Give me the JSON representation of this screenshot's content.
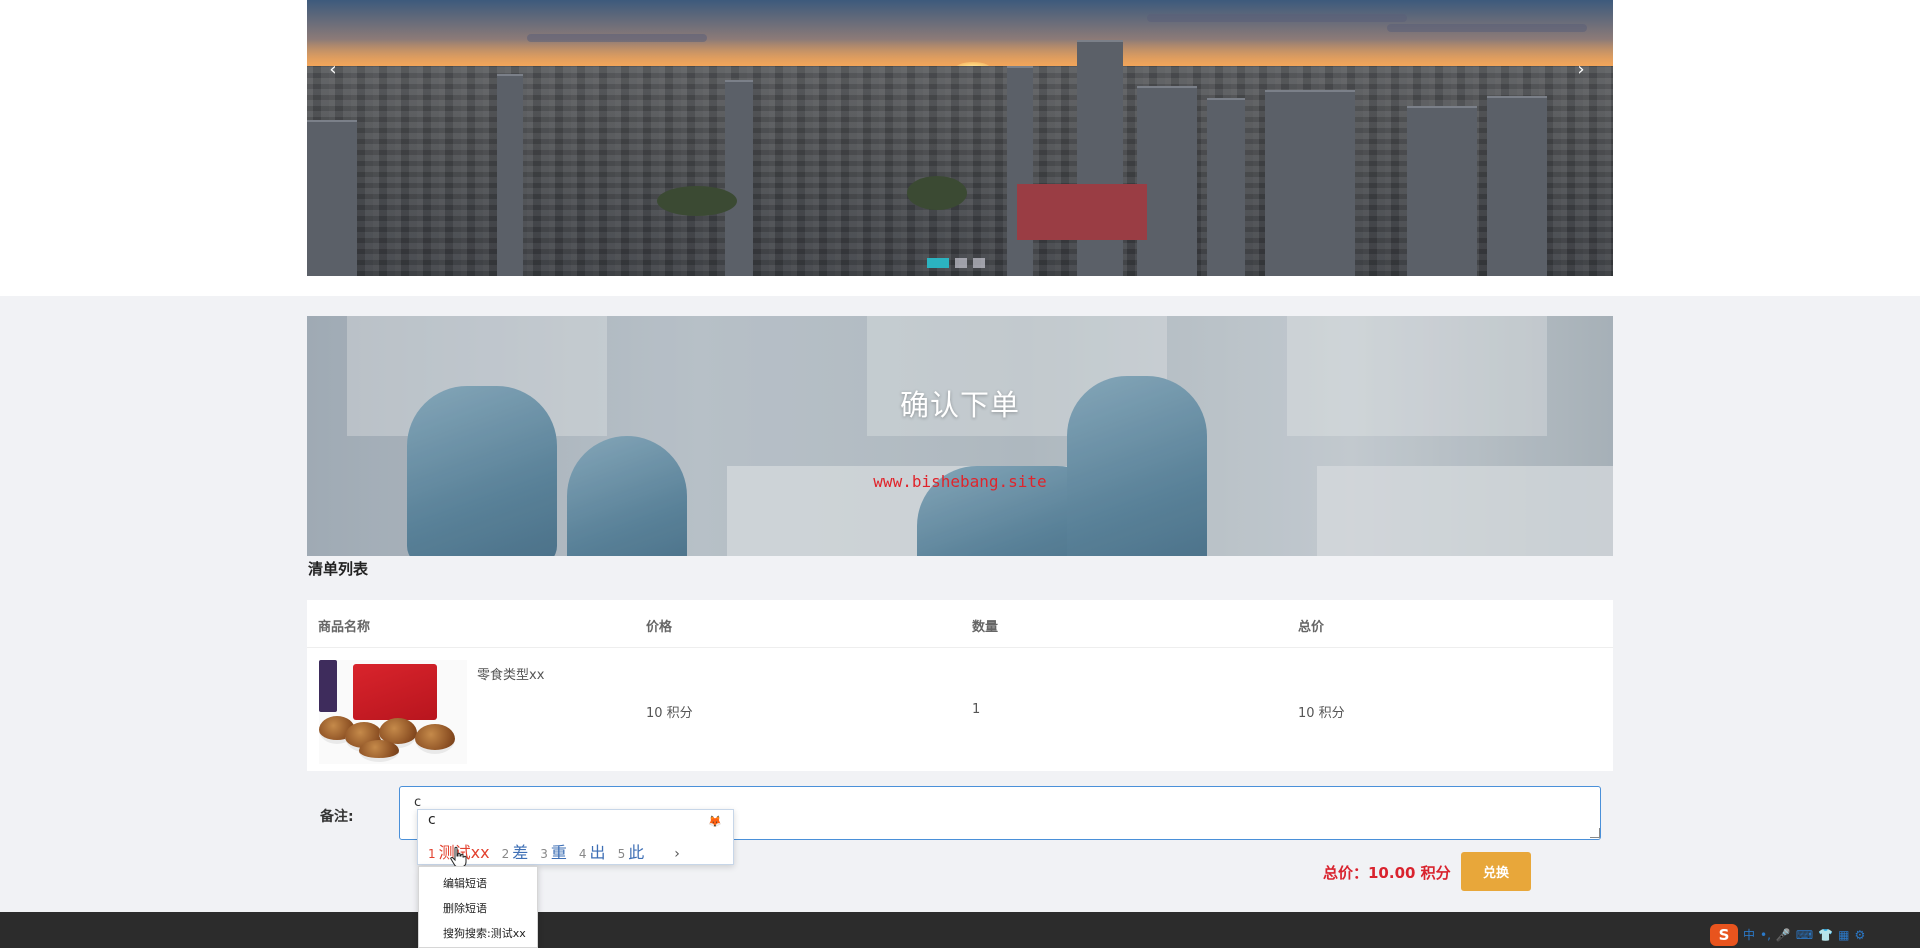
{
  "carousel": {
    "prev_arrow": "‹",
    "next_arrow": "›",
    "slide_count": 3,
    "active_slide": 1
  },
  "banner": {
    "title": "确认下单",
    "watermark": "www.bishebang.site"
  },
  "list": {
    "heading": "清单列表",
    "columns": [
      "商品名称",
      "价格",
      "数量",
      "总价"
    ],
    "rows": [
      {
        "name": "零食类型xx",
        "price": "10 积分",
        "quantity": "1",
        "total": "10 积分"
      }
    ]
  },
  "remark": {
    "label": "备注:",
    "value": "c"
  },
  "summary": {
    "total_label": "总价：10.00 积分",
    "exchange_button": "兑换"
  },
  "ime": {
    "pinyin": "c",
    "candidates": [
      {
        "num": "1",
        "text": "测试xx"
      },
      {
        "num": "2",
        "text": "差"
      },
      {
        "num": "3",
        "text": "重"
      },
      {
        "num": "4",
        "text": "出"
      },
      {
        "num": "5",
        "text": "此"
      }
    ],
    "next": "›",
    "menu": [
      "编辑短语",
      "删除短语",
      "搜狗搜索:测试xx"
    ]
  },
  "tray": {
    "logo": "S",
    "items": [
      "中",
      "•,",
      "🎤",
      "⌨",
      "👕",
      "▦",
      "⚙"
    ]
  },
  "colors": {
    "accent_teal": "#2bb3c0",
    "price_red": "#d9232e",
    "button_orange": "#e8a73a",
    "footer_dark": "#2c2c2c",
    "page_bg": "#f1f2f5"
  }
}
